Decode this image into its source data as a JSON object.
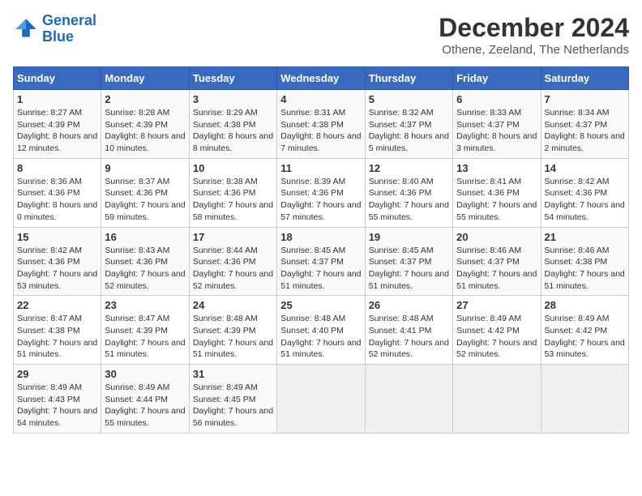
{
  "logo": {
    "line1": "General",
    "line2": "Blue"
  },
  "title": "December 2024",
  "subtitle": "Othene, Zeeland, The Netherlands",
  "weekdays": [
    "Sunday",
    "Monday",
    "Tuesday",
    "Wednesday",
    "Thursday",
    "Friday",
    "Saturday"
  ],
  "weeks": [
    [
      {
        "day": "1",
        "sunrise": "8:27 AM",
        "sunset": "4:39 PM",
        "daylight": "8 hours and 12 minutes."
      },
      {
        "day": "2",
        "sunrise": "8:28 AM",
        "sunset": "4:39 PM",
        "daylight": "8 hours and 10 minutes."
      },
      {
        "day": "3",
        "sunrise": "8:29 AM",
        "sunset": "4:38 PM",
        "daylight": "8 hours and 8 minutes."
      },
      {
        "day": "4",
        "sunrise": "8:31 AM",
        "sunset": "4:38 PM",
        "daylight": "8 hours and 7 minutes."
      },
      {
        "day": "5",
        "sunrise": "8:32 AM",
        "sunset": "4:37 PM",
        "daylight": "8 hours and 5 minutes."
      },
      {
        "day": "6",
        "sunrise": "8:33 AM",
        "sunset": "4:37 PM",
        "daylight": "8 hours and 3 minutes."
      },
      {
        "day": "7",
        "sunrise": "8:34 AM",
        "sunset": "4:37 PM",
        "daylight": "8 hours and 2 minutes."
      }
    ],
    [
      {
        "day": "8",
        "sunrise": "8:36 AM",
        "sunset": "4:36 PM",
        "daylight": "8 hours and 0 minutes."
      },
      {
        "day": "9",
        "sunrise": "8:37 AM",
        "sunset": "4:36 PM",
        "daylight": "7 hours and 59 minutes."
      },
      {
        "day": "10",
        "sunrise": "8:38 AM",
        "sunset": "4:36 PM",
        "daylight": "7 hours and 58 minutes."
      },
      {
        "day": "11",
        "sunrise": "8:39 AM",
        "sunset": "4:36 PM",
        "daylight": "7 hours and 57 minutes."
      },
      {
        "day": "12",
        "sunrise": "8:40 AM",
        "sunset": "4:36 PM",
        "daylight": "7 hours and 55 minutes."
      },
      {
        "day": "13",
        "sunrise": "8:41 AM",
        "sunset": "4:36 PM",
        "daylight": "7 hours and 55 minutes."
      },
      {
        "day": "14",
        "sunrise": "8:42 AM",
        "sunset": "4:36 PM",
        "daylight": "7 hours and 54 minutes."
      }
    ],
    [
      {
        "day": "15",
        "sunrise": "8:42 AM",
        "sunset": "4:36 PM",
        "daylight": "7 hours and 53 minutes."
      },
      {
        "day": "16",
        "sunrise": "8:43 AM",
        "sunset": "4:36 PM",
        "daylight": "7 hours and 52 minutes."
      },
      {
        "day": "17",
        "sunrise": "8:44 AM",
        "sunset": "4:36 PM",
        "daylight": "7 hours and 52 minutes."
      },
      {
        "day": "18",
        "sunrise": "8:45 AM",
        "sunset": "4:37 PM",
        "daylight": "7 hours and 51 minutes."
      },
      {
        "day": "19",
        "sunrise": "8:45 AM",
        "sunset": "4:37 PM",
        "daylight": "7 hours and 51 minutes."
      },
      {
        "day": "20",
        "sunrise": "8:46 AM",
        "sunset": "4:37 PM",
        "daylight": "7 hours and 51 minutes."
      },
      {
        "day": "21",
        "sunrise": "8:46 AM",
        "sunset": "4:38 PM",
        "daylight": "7 hours and 51 minutes."
      }
    ],
    [
      {
        "day": "22",
        "sunrise": "8:47 AM",
        "sunset": "4:38 PM",
        "daylight": "7 hours and 51 minutes."
      },
      {
        "day": "23",
        "sunrise": "8:47 AM",
        "sunset": "4:39 PM",
        "daylight": "7 hours and 51 minutes."
      },
      {
        "day": "24",
        "sunrise": "8:48 AM",
        "sunset": "4:39 PM",
        "daylight": "7 hours and 51 minutes."
      },
      {
        "day": "25",
        "sunrise": "8:48 AM",
        "sunset": "4:40 PM",
        "daylight": "7 hours and 51 minutes."
      },
      {
        "day": "26",
        "sunrise": "8:48 AM",
        "sunset": "4:41 PM",
        "daylight": "7 hours and 52 minutes."
      },
      {
        "day": "27",
        "sunrise": "8:49 AM",
        "sunset": "4:42 PM",
        "daylight": "7 hours and 52 minutes."
      },
      {
        "day": "28",
        "sunrise": "8:49 AM",
        "sunset": "4:42 PM",
        "daylight": "7 hours and 53 minutes."
      }
    ],
    [
      {
        "day": "29",
        "sunrise": "8:49 AM",
        "sunset": "4:43 PM",
        "daylight": "7 hours and 54 minutes."
      },
      {
        "day": "30",
        "sunrise": "8:49 AM",
        "sunset": "4:44 PM",
        "daylight": "7 hours and 55 minutes."
      },
      {
        "day": "31",
        "sunrise": "8:49 AM",
        "sunset": "4:45 PM",
        "daylight": "7 hours and 56 minutes."
      },
      null,
      null,
      null,
      null
    ]
  ]
}
